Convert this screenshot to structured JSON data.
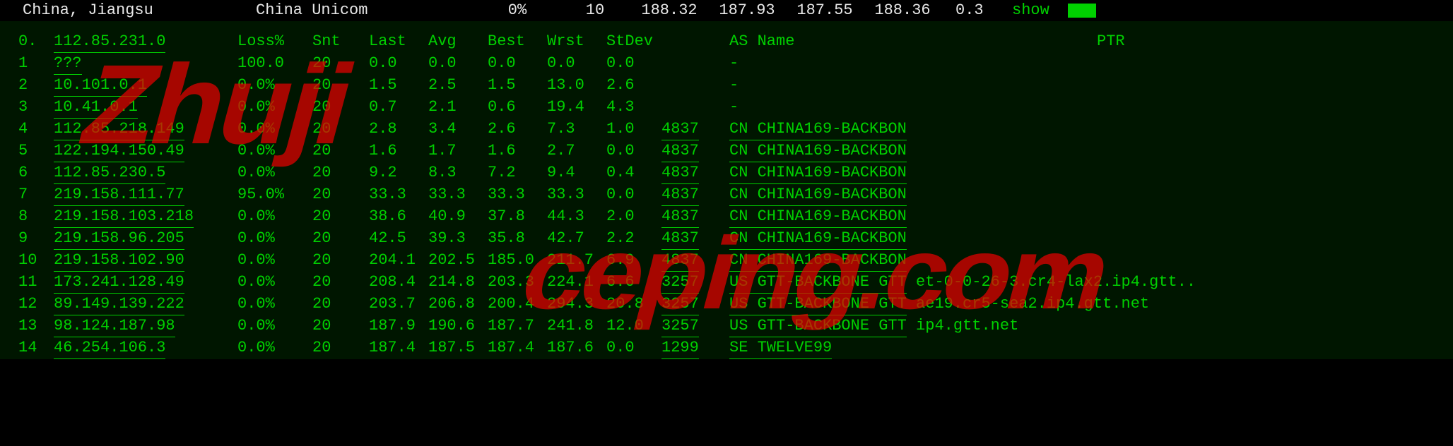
{
  "summary": {
    "location": "China, Jiangsu",
    "isp": "China Unicom",
    "loss_pct": "0%",
    "count": "10",
    "p1": "188.32",
    "p2": "187.93",
    "p3": "187.55",
    "p4": "188.36",
    "jitter": "0.3",
    "show": "show"
  },
  "headers": {
    "idx": "0.",
    "host": "112.85.231.0",
    "loss": "Loss%",
    "snt": "Snt",
    "last": "Last",
    "avg": "Avg",
    "best": "Best",
    "wrst": "Wrst",
    "stdev": "StDev",
    "asname": "AS Name",
    "ptr": "PTR"
  },
  "hops": [
    {
      "idx": "1",
      "host": "???",
      "loss": "100.0",
      "snt": "20",
      "last": "0.0",
      "avg": "0.0",
      "best": "0.0",
      "wrst": "0.0",
      "stdev": "0.0",
      "as": "",
      "asname": "-",
      "ptr": ""
    },
    {
      "idx": "2",
      "host": "10.101.0.1",
      "loss": "0.0%",
      "snt": "20",
      "last": "1.5",
      "avg": "2.5",
      "best": "1.5",
      "wrst": "13.0",
      "stdev": "2.6",
      "as": "",
      "asname": "-",
      "ptr": ""
    },
    {
      "idx": "3",
      "host": "10.41.0.1",
      "loss": "0.0%",
      "snt": "20",
      "last": "0.7",
      "avg": "2.1",
      "best": "0.6",
      "wrst": "19.4",
      "stdev": "4.3",
      "as": "",
      "asname": "-",
      "ptr": ""
    },
    {
      "idx": "4",
      "host": "112.85.218.149",
      "loss": "0.0%",
      "snt": "20",
      "last": "2.8",
      "avg": "3.4",
      "best": "2.6",
      "wrst": "7.3",
      "stdev": "1.0",
      "as": "4837",
      "asname": "CN CHINA169-BACKBON",
      "ptr": ""
    },
    {
      "idx": "5",
      "host": "122.194.150.49",
      "loss": "0.0%",
      "snt": "20",
      "last": "1.6",
      "avg": "1.7",
      "best": "1.6",
      "wrst": "2.7",
      "stdev": "0.0",
      "as": "4837",
      "asname": "CN CHINA169-BACKBON",
      "ptr": ""
    },
    {
      "idx": "6",
      "host": "112.85.230.5",
      "loss": "0.0%",
      "snt": "20",
      "last": "9.2",
      "avg": "8.3",
      "best": "7.2",
      "wrst": "9.4",
      "stdev": "0.4",
      "as": "4837",
      "asname": "CN CHINA169-BACKBON",
      "ptr": ""
    },
    {
      "idx": "7",
      "host": "219.158.111.77",
      "loss": "95.0%",
      "snt": "20",
      "last": "33.3",
      "avg": "33.3",
      "best": "33.3",
      "wrst": "33.3",
      "stdev": "0.0",
      "as": "4837",
      "asname": "CN CHINA169-BACKBON",
      "ptr": ""
    },
    {
      "idx": "8",
      "host": "219.158.103.218",
      "loss": "0.0%",
      "snt": "20",
      "last": "38.6",
      "avg": "40.9",
      "best": "37.8",
      "wrst": "44.3",
      "stdev": "2.0",
      "as": "4837",
      "asname": "CN CHINA169-BACKBON",
      "ptr": ""
    },
    {
      "idx": "9",
      "host": "219.158.96.205",
      "loss": "0.0%",
      "snt": "20",
      "last": "42.5",
      "avg": "39.3",
      "best": "35.8",
      "wrst": "42.7",
      "stdev": "2.2",
      "as": "4837",
      "asname": "CN CHINA169-BACKBON",
      "ptr": ""
    },
    {
      "idx": "10",
      "host": "219.158.102.90",
      "loss": "0.0%",
      "snt": "20",
      "last": "204.1",
      "avg": "202.5",
      "best": "185.0",
      "wrst": "211.7",
      "stdev": "6.9",
      "as": "4837",
      "asname": "CN CHINA169-BACKBON",
      "ptr": ""
    },
    {
      "idx": "11",
      "host": "173.241.128.49",
      "loss": "0.0%",
      "snt": "20",
      "last": "208.4",
      "avg": "214.8",
      "best": "203.3",
      "wrst": "224.1",
      "stdev": "6.6",
      "as": "3257",
      "asname": "US GTT-BACKBONE GTT",
      "ptr": "et-0-0-26-3.cr4-lax2.ip4.gtt.."
    },
    {
      "idx": "12",
      "host": "89.149.139.222",
      "loss": "0.0%",
      "snt": "20",
      "last": "203.7",
      "avg": "206.8",
      "best": "200.4",
      "wrst": "294.3",
      "stdev": "20.8",
      "as": "3257",
      "asname": "US GTT-BACKBONE GTT",
      "ptr": "ae19.cr5-sea2.ip4.gtt.net"
    },
    {
      "idx": "13",
      "host": "98.124.187.98",
      "loss": "0.0%",
      "snt": "20",
      "last": "187.9",
      "avg": "190.6",
      "best": "187.7",
      "wrst": "241.8",
      "stdev": "12.0",
      "as": "3257",
      "asname": "US GTT-BACKBONE GTT",
      "ptr": "ip4.gtt.net"
    },
    {
      "idx": "14",
      "host": "46.254.106.3",
      "loss": "0.0%",
      "snt": "20",
      "last": "187.4",
      "avg": "187.5",
      "best": "187.4",
      "wrst": "187.6",
      "stdev": "0.0",
      "as": "1299",
      "asname": "SE TWELVE99",
      "ptr": ""
    }
  ],
  "watermark": "Zhujiceping.com"
}
